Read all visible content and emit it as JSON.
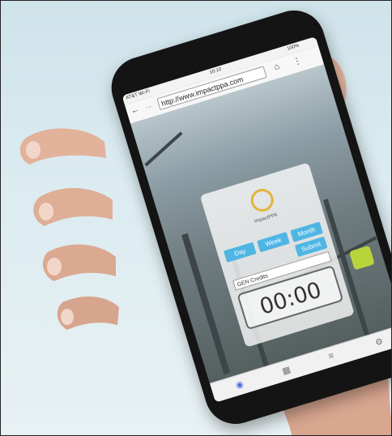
{
  "status": {
    "carrier": "AT&T Wi-Fi",
    "time": "10:10",
    "battery": "100%"
  },
  "browser": {
    "url": "http://www.impactppa.com",
    "back_icon": "arrow-left-icon",
    "forward_icon": "arrow-right-icon",
    "home_icon": "home-icon",
    "menu_icon": "kebab-menu-icon"
  },
  "card": {
    "app_name": "ImpactPPA",
    "buttons": {
      "day": "Day",
      "week": "Week",
      "month": "Month",
      "submit": "Submit"
    },
    "field_label": "GEN Credits",
    "timer": "00:00"
  },
  "nav": {
    "items": [
      "compass-icon",
      "book-icon",
      "list-icon",
      "gear-icon"
    ]
  },
  "colors": {
    "accent": "#4fb6e4",
    "logo": "#e1b43b",
    "phone": "#141414"
  }
}
